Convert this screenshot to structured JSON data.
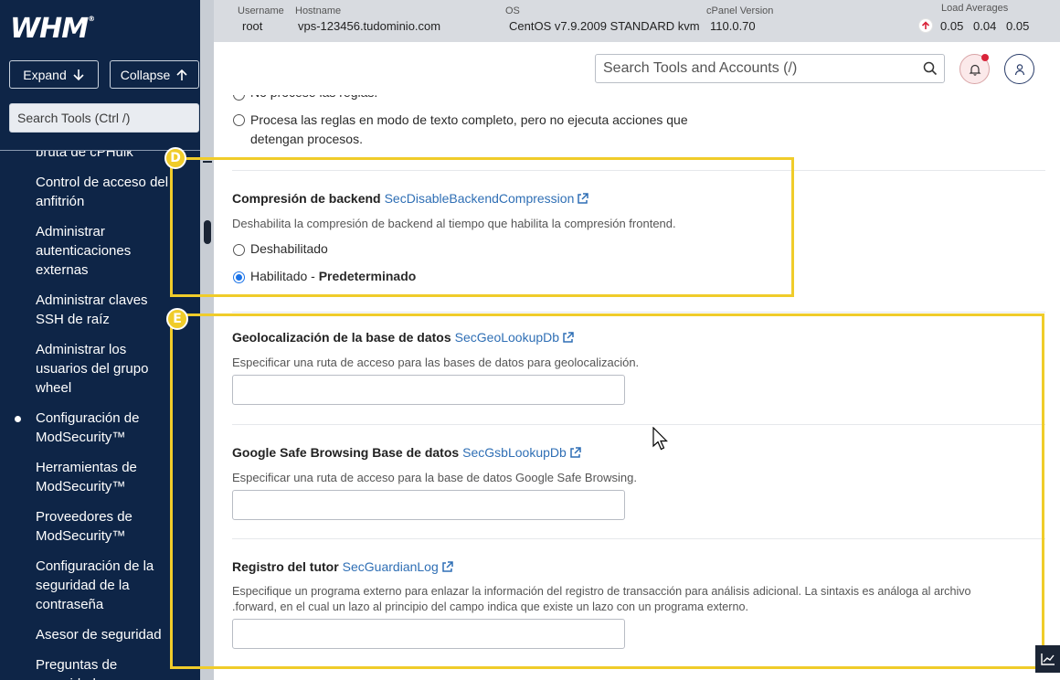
{
  "app": {
    "logo": "WHM",
    "logo_mark": "®"
  },
  "sidebar": {
    "expand_label": "Expand",
    "collapse_label": "Collapse",
    "search_placeholder": "Search Tools (Ctrl /)",
    "items": [
      {
        "label": "bruta de cPHulk"
      },
      {
        "label": "Control de acceso del anfitrión"
      },
      {
        "label": "Administrar autenticaciones externas"
      },
      {
        "label": "Administrar claves SSH de raíz"
      },
      {
        "label": "Administrar los usuarios del grupo wheel"
      },
      {
        "label": "Configuración de ModSecurity™"
      },
      {
        "label": "Herramientas de ModSecurity™"
      },
      {
        "label": "Proveedores de ModSecurity™"
      },
      {
        "label": "Configuración de la seguridad de la contraseña"
      },
      {
        "label": "Asesor de seguridad"
      },
      {
        "label": "Preguntas de seguridad"
      }
    ],
    "active_item": "Configuración de ModSecurity™"
  },
  "topbar": {
    "username_label": "Username",
    "username": "root",
    "hostname_label": "Hostname",
    "hostname": "vps-123456.tudominio.com",
    "os_label": "OS",
    "os": "CentOS v7.9.2009 STANDARD kvm",
    "cpanel_label": "cPanel Version",
    "cpanel_version": "110.0.70",
    "load_label": "Load Averages",
    "load_1": "0.05",
    "load_5": "0.04",
    "load_15": "0.05"
  },
  "header": {
    "search_placeholder": "Search Tools and Accounts (/)"
  },
  "content": {
    "prev_option_partial": "No procese las reglas.",
    "prev_option_fulltext_line1": "Procesa las reglas en modo de texto completo, pero no ejecuta acciones que",
    "prev_option_fulltext_line2": "detengan procesos.",
    "backend": {
      "title": "Compresión de backend",
      "directive": "SecDisableBackendCompression",
      "description": "Deshabilita la compresión de backend al tiempo que habilita la compresión frontend.",
      "option_disabled": "Deshabilitado",
      "option_enabled": "Habilitado",
      "option_enabled_sep": " - ",
      "option_enabled_default": "Predeterminado"
    },
    "geo": {
      "title": "Geolocalización de la base de datos",
      "directive": "SecGeoLookupDb",
      "description": "Especificar una ruta de acceso para las bases de datos para geolocalización.",
      "value": ""
    },
    "gsb": {
      "title": "Google Safe Browsing Base de datos",
      "directive": "SecGsbLookupDb",
      "description": "Especificar una ruta de acceso para la base de datos Google Safe Browsing.",
      "value": ""
    },
    "guardian": {
      "title": "Registro del tutor",
      "directive": "SecGuardianLog",
      "description_line1": "Especifique un programa externo para enlazar la información del registro de transacción para análisis adicional. La sintaxis es análoga al archivo",
      "description_line2": ".forward, en el cual un lazo al principio del campo indica que existe un lazo con un programa externo.",
      "value": ""
    }
  },
  "annotations": {
    "badge_d": "D",
    "badge_e": "E",
    "color": "#f0cc2a"
  },
  "colors": {
    "sidebar_bg": "#0e2547",
    "link": "#2f6fb5",
    "radio_checked": "#1a73e8",
    "notification_dot": "#d9243a"
  }
}
